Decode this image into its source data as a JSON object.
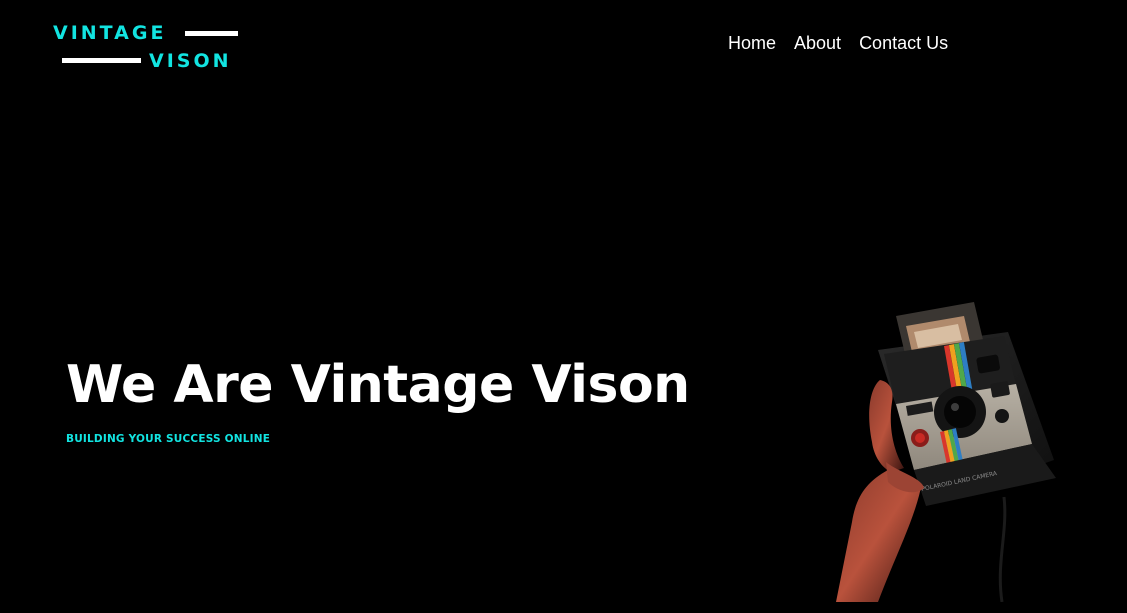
{
  "logo": {
    "word_top": "VINTAGE",
    "word_bottom": "VISON",
    "color": "#12e4e1"
  },
  "nav": {
    "items": [
      {
        "label": "Home"
      },
      {
        "label": "About"
      },
      {
        "label": "Contact Us"
      }
    ]
  },
  "hero": {
    "title": "We Are Vintage Vison",
    "subtitle": "BUILDING YOUR SUCCESS ONLINE",
    "image_text": "POLAROID LAND CAMERA",
    "background": "#000000",
    "accent": "#12e4e1"
  }
}
